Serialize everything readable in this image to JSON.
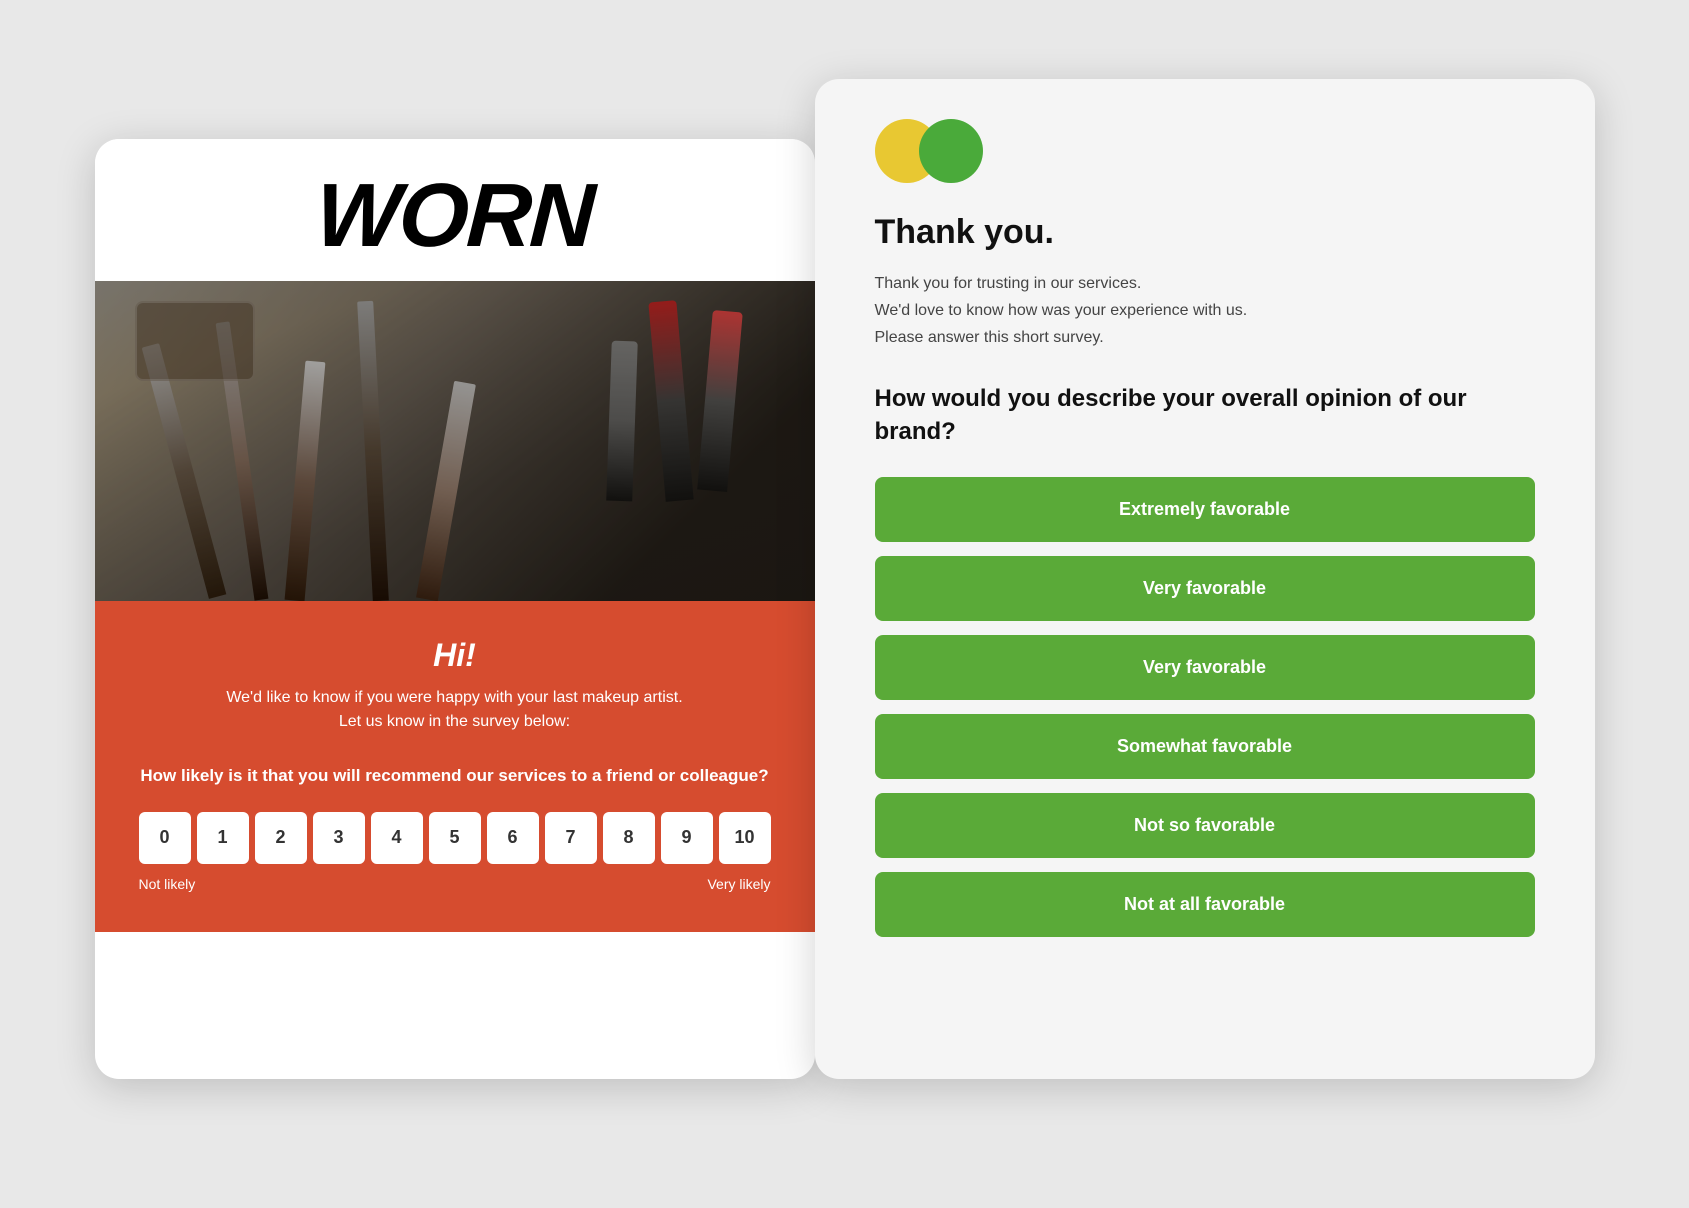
{
  "left_card": {
    "logo_text": "WORN",
    "greeting": "Hi!",
    "subtitle_line1": "We'd like to know if you were happy with your last makeup artist.",
    "subtitle_line2": "Let us know in the survey below:",
    "nps_question": "How likely is it that you will recommend our services to a friend or colleague?",
    "nps_values": [
      "0",
      "1",
      "2",
      "3",
      "4",
      "5",
      "6",
      "7",
      "8",
      "9",
      "10"
    ],
    "nps_label_left": "Not likely",
    "nps_label_right": "Very likely"
  },
  "right_card": {
    "logo_circles": {
      "circle1_color": "#e8c832",
      "circle2_color": "#4aaa3a"
    },
    "title": "Thank you.",
    "description_line1": "Thank you for trusting in our services.",
    "description_line2": "We'd love to know how was your experience with us.",
    "description_line3": "Please answer this short survey.",
    "survey_question": "How would you describe your overall opinion of our brand?",
    "options": [
      "Extremely favorable",
      "Very favorable",
      "Very favorable",
      "Somewhat favorable",
      "Not so favorable",
      "Not at all favorable"
    ]
  }
}
